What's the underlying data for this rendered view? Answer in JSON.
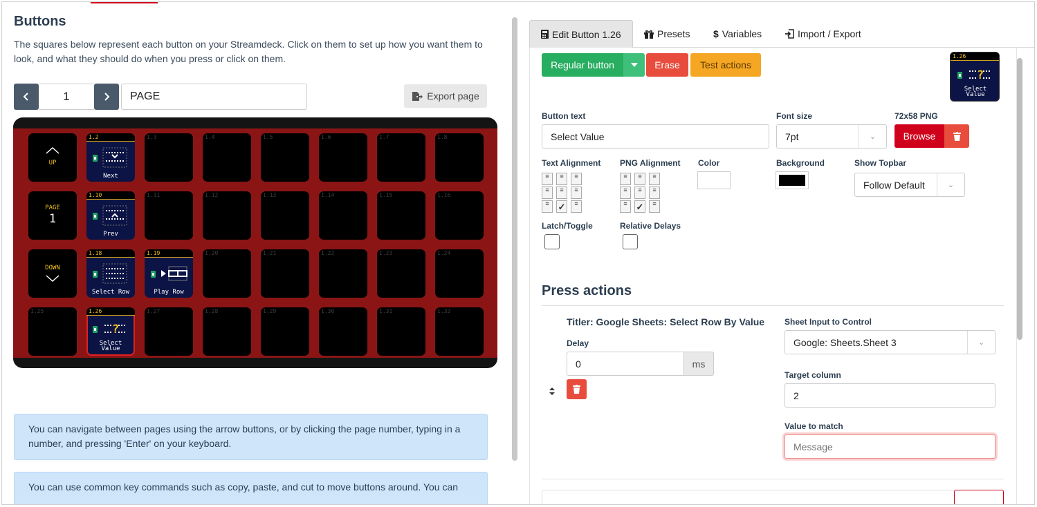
{
  "left": {
    "title": "Buttons",
    "description": "The squares below represent each button on your Streamdeck. Click on them to set up how you want them to look, and what they should do when you press or click on them.",
    "page_number": "1",
    "page_name": "PAGE",
    "export_label": "Export page",
    "prev_icon": "chevron-left-icon",
    "next_icon": "chevron-right-icon",
    "controls": {
      "up": "UP",
      "page": "PAGE",
      "page_num": "1",
      "down": "DOWN"
    },
    "keys": [
      "1.2",
      "1.3",
      "1.4",
      "1.5",
      "1.6",
      "1.7",
      "1.8",
      "1.10",
      "1.11",
      "1.12",
      "1.13",
      "1.14",
      "1.15",
      "1.16",
      "1.18",
      "1.19",
      "1.20",
      "1.21",
      "1.22",
      "1.23",
      "1.24",
      "1.25",
      "1.26",
      "1.27",
      "1.28",
      "1.29",
      "1.30",
      "1.31",
      "1.32"
    ],
    "key_labels": {
      "next": "Next",
      "prev": "Prev",
      "select_row": "Select Row",
      "play_row": "Play Row",
      "select_value_1": "Select",
      "select_value_2": "Value"
    },
    "info1": "You can navigate between pages using the arrow buttons, or by clicking the page number, typing in a number, and pressing 'Enter' on your keyboard.",
    "info2": "You can use common key commands such as copy, paste, and cut to move buttons around. You can"
  },
  "right": {
    "tabs": [
      {
        "label": "Edit Button 1.26",
        "icon": "calculator-icon"
      },
      {
        "label": "Presets",
        "icon": "gift-icon"
      },
      {
        "label": "Variables",
        "icon": "dollar-icon"
      },
      {
        "label": "Import / Export",
        "icon": "import-icon"
      }
    ],
    "regular_button": "Regular button",
    "erase": "Erase",
    "test_actions": "Test actions",
    "preview_num": "1.26",
    "preview_label_1": "Select",
    "preview_label_2": "Value",
    "button_text_label": "Button text",
    "button_text_value": "Select Value",
    "font_size_label": "Font size",
    "font_size_value": "7pt",
    "png_label": "72x58 PNG",
    "browse": "Browse",
    "text_alignment_label": "Text Alignment",
    "png_alignment_label": "PNG Alignment",
    "color_label": "Color",
    "background_label": "Background",
    "show_topbar_label": "Show Topbar",
    "show_topbar_value": "Follow Default",
    "latch_label": "Latch/Toggle",
    "relative_delays_label": "Relative Delays",
    "press_actions_title": "Press actions",
    "action_title": "Titler: Google Sheets: Select Row By Value",
    "delay_label": "Delay",
    "delay_value": "0",
    "delay_unit": "ms",
    "sheet_input_label": "Sheet Input to Control",
    "sheet_input_value": "Google: Sheets.Sheet 3",
    "target_column_label": "Target column",
    "target_column_value": "2",
    "value_to_match_label": "Value to match",
    "value_to_match_placeholder": "Message"
  },
  "colors": {
    "green": "#27ae60",
    "red": "#e74c3c",
    "orange": "#f5a623",
    "deck_red": "#8b1515"
  }
}
